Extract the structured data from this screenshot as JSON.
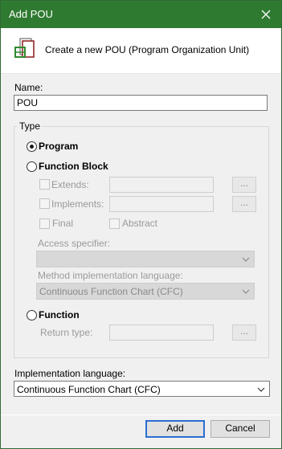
{
  "window": {
    "title": "Add POU"
  },
  "header": {
    "text": "Create a new POU (Program Organization Unit)"
  },
  "name_field": {
    "label": "Name:",
    "value": "POU"
  },
  "type_group": {
    "title": "Type",
    "program_label": "Program",
    "function_block_label": "Function Block",
    "extends_label": "Extends:",
    "implements_label": "Implements:",
    "final_label": "Final",
    "abstract_label": "Abstract",
    "access_specifier_label": "Access specifier:",
    "access_specifier_value": "",
    "method_impl_label": "Method implementation language:",
    "method_impl_value": "Continuous Function Chart (CFC)",
    "function_label": "Function",
    "return_type_label": "Return type:",
    "browse_label": "..."
  },
  "implementation": {
    "label": "Implementation language:",
    "value": "Continuous Function Chart (CFC)"
  },
  "buttons": {
    "add": "Add",
    "cancel": "Cancel"
  },
  "colors": {
    "titlebar": "#2f7a31",
    "accent_border": "#2b6ed1"
  },
  "icons": {
    "close": "close-icon",
    "pou": "pou-icon",
    "dropdown": "chevron-down-icon"
  }
}
